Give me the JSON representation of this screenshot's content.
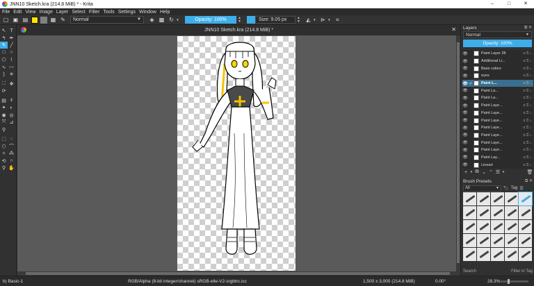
{
  "window": {
    "title": "JNN10 Sketch.kra (214.8 MiB) * - Krita",
    "minimize": "–",
    "maximize": "□",
    "close": "✕"
  },
  "menu": [
    "File",
    "Edit",
    "View",
    "Image",
    "Layer",
    "Select",
    "Filter",
    "Tools",
    "Settings",
    "Window",
    "Help"
  ],
  "toolbar": {
    "blend_mode": "Normal",
    "opacity_label": "Opacity: 100%",
    "size_label": "Size: 9.05 px",
    "fg_color": "#ffe800",
    "bg_color": "#808080",
    "accent": "#3daee9"
  },
  "document": {
    "tab_title": "JNN10 Sketch.kra (214.8 MiB) *",
    "close": "✕"
  },
  "layers_docker": {
    "title": "Layers",
    "blend_mode": "Normal",
    "opacity_label": "Opacity:  100%",
    "items": [
      {
        "name": "Paint Layer 28",
        "selected": false,
        "checked": false
      },
      {
        "name": "Additional Li...",
        "selected": false,
        "checked": false
      },
      {
        "name": "Base colors",
        "selected": false,
        "checked": false
      },
      {
        "name": "eyes",
        "selected": false,
        "checked": false
      },
      {
        "name": "Paint L...",
        "selected": true,
        "checked": true
      },
      {
        "name": "Paint La...",
        "selected": false,
        "checked": false
      },
      {
        "name": "Paint La...",
        "selected": false,
        "checked": false
      },
      {
        "name": "Paint Laye...",
        "selected": false,
        "checked": false
      },
      {
        "name": "Paint Laye...",
        "selected": false,
        "checked": false
      },
      {
        "name": "Paint Laye...",
        "selected": false,
        "checked": false
      },
      {
        "name": "Paint Laye...",
        "selected": false,
        "checked": false
      },
      {
        "name": "Paint Laye...",
        "selected": false,
        "checked": false
      },
      {
        "name": "Paint Laye...",
        "selected": false,
        "checked": false
      },
      {
        "name": "Paint Laye...",
        "selected": false,
        "checked": false
      },
      {
        "name": "Paint Lay...",
        "selected": false,
        "checked": false
      },
      {
        "name": "Lineart",
        "selected": false,
        "checked": false
      }
    ]
  },
  "brush_presets": {
    "title": "Brush Presets",
    "filter": "All",
    "tag_label": "Tag",
    "search_placeholder": "Search",
    "filter_in_tag": "Filter in Tag"
  },
  "status": {
    "brush": "b) Basic-1",
    "color_space": "RGB/Alpha (8-bit integer/channel)  sRGB-elle-V2-srgbtrc.icc",
    "dimensions": "1,500 x 3,000 (214.8 MiB)",
    "rotation": "0.00°",
    "zoom": "28.3%"
  }
}
